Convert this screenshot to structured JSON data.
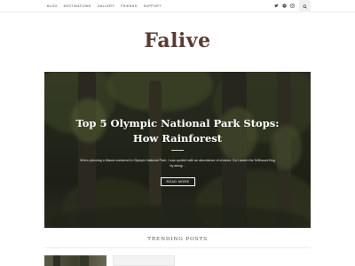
{
  "nav": {
    "items": [
      "BLOG",
      "DESTINATIONS",
      "GALLERY",
      "FRIENDS",
      "SUPPORT"
    ]
  },
  "social": {
    "icons": [
      "twitter-icon",
      "pinterest-icon",
      "instagram-icon"
    ]
  },
  "search": {
    "icon": "search-icon"
  },
  "logo": {
    "text": "Falive"
  },
  "hero": {
    "title_line1": "Top 5 Olympic National Park Stops:",
    "title_line2": "How Rainforest",
    "excerpt": "When planning a Mason weekend in Olympic National Park, I was spoiled with an abundance of choices. Do I watch the Driftwood Bog by along...",
    "button_label": "READ MORE"
  },
  "trending": {
    "title": "TRENDING POSTS"
  },
  "colors": {
    "logo": "#5a3b33",
    "search_bg": "#f0f0f0",
    "hero_overlay": "rgba(0,0,0,0.28)"
  }
}
